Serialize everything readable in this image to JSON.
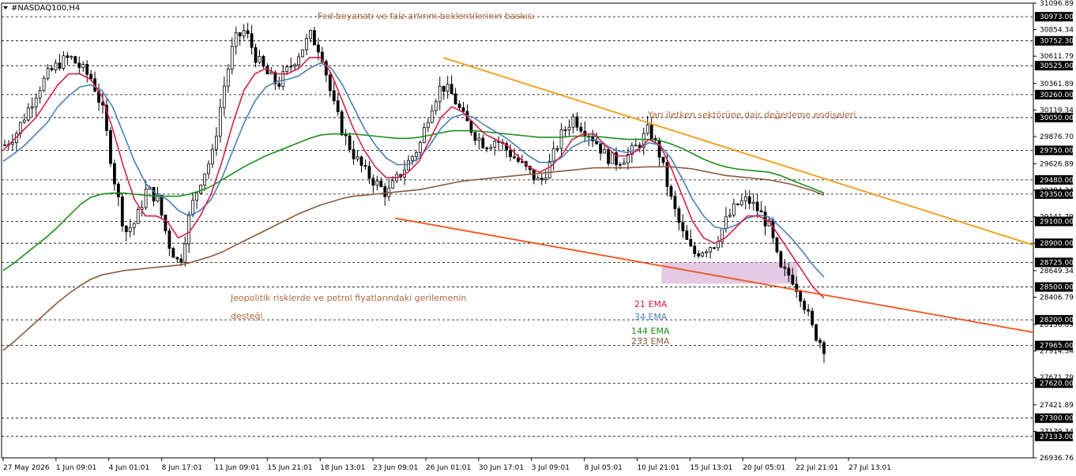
{
  "symbol": "#NASDAQ100,H4",
  "colors": {
    "bull": "#000000",
    "bear": "#000000",
    "ema21": "#d1204a",
    "ema34": "#4a7fb5",
    "ema144": "#1b8f1b",
    "ema233": "#8b5a3c",
    "orange": "#f59a14",
    "redline": "#f2531c",
    "zone": "#d8b4d8",
    "levelTag": "#000000",
    "priceTag": "#000000"
  },
  "annotations": {
    "fed": "Fed beyanatı ve faiz artırım beklentilerinin baskısı",
    "semi": "Yarı iletken sektörüne dair değerleme endişeleri",
    "geo1": "Jeopolitik risklerde ve petrol fiyatlarındaki gerilemenin",
    "geo2": "desteği"
  },
  "legend": [
    "21 EMA",
    "34 EMA",
    "144 EMA",
    "233 EMA"
  ],
  "chart_data": {
    "type": "candlestick",
    "title": "#NASDAQ100,H4",
    "ylim": [
      26936.76,
      31096.89
    ],
    "price_axis_labels": [
      "31096.89",
      "30854.34",
      "30611.79",
      "30361.89",
      "30119.34",
      "29876.70",
      "29626.89",
      "29384.34",
      "29141.79",
      "28900.00",
      "28649.34",
      "28406.79",
      "28156.89",
      "27914.34",
      "27671.79",
      "27421.89",
      "27179.34",
      "26936.76"
    ],
    "horizontal_levels": [
      30973.0,
      30752.3,
      30525.0,
      30260.0,
      30050.0,
      29750.0,
      29480.0,
      29350.0,
      29100.0,
      28900.0,
      28725.0,
      28500.0,
      28200.0,
      27965.0,
      27620.0,
      27300.0,
      27133.0
    ],
    "x_labels": [
      "27 May 2026",
      "1 Jun 09:01",
      "4 Jun 01:01",
      "8 Jun 17:01",
      "11 Jun 09:01",
      "15 Jun 21:01",
      "18 Jun 13:01",
      "23 Jun 09:01",
      "26 Jun 01:01",
      "30 Jun 17:01",
      "3 Jul 09:01",
      "8 Jul 05:01",
      "10 Jul 21:01",
      "15 Jul 13:01",
      "20 Jul 05:01",
      "22 Jul 21:01",
      "27 Jul 13:01"
    ],
    "close_path": [
      29800,
      29900,
      30100,
      30300,
      30450,
      30550,
      30600,
      30500,
      30400,
      30100,
      29500,
      29000,
      29100,
      29400,
      29300,
      28900,
      28700,
      29200,
      29500,
      29700,
      30300,
      30750,
      30850,
      30600,
      30450,
      30350,
      30500,
      30650,
      30800,
      30650,
      30200,
      29900,
      29700,
      29550,
      29450,
      29350,
      29500,
      29650,
      29800,
      30150,
      30350,
      30250,
      30050,
      29900,
      29800,
      29850,
      29750,
      29650,
      29550,
      29450,
      29650,
      29900,
      30050,
      29950,
      29850,
      29700,
      29650,
      29700,
      29800,
      29950,
      29700,
      29300,
      29000,
      28800,
      28850,
      28900,
      29100,
      29250,
      29300,
      29200,
      29050,
      28650,
      28600,
      28400,
      28100,
      27950
    ],
    "ema21_path": [
      29750,
      29850,
      29950,
      30050,
      30200,
      30350,
      30450,
      30450,
      30400,
      30250,
      29950,
      29600,
      29300,
      29150,
      29150,
      29100,
      28950,
      29000,
      29150,
      29350,
      29650,
      30000,
      30300,
      30450,
      30500,
      30450,
      30450,
      30500,
      30600,
      30600,
      30450,
      30200,
      29950,
      29750,
      29600,
      29500,
      29500,
      29550,
      29650,
      29850,
      30050,
      30150,
      30100,
      30000,
      29900,
      29850,
      29800,
      29700,
      29600,
      29550,
      29600,
      29700,
      29850,
      29900,
      29900,
      29800,
      29700,
      29700,
      29750,
      29850,
      29800,
      29600,
      29350,
      29100,
      28950,
      28900,
      28950,
      29050,
      29150,
      29150,
      29100,
      28950,
      28800,
      28650,
      28500,
      28400
    ],
    "ema34_path": [
      29650,
      29720,
      29800,
      29900,
      30000,
      30150,
      30250,
      30330,
      30350,
      30300,
      30150,
      29900,
      29650,
      29450,
      29350,
      29300,
      29200,
      29150,
      29200,
      29300,
      29500,
      29750,
      30000,
      30200,
      30330,
      30380,
      30400,
      30430,
      30500,
      30550,
      30500,
      30350,
      30150,
      29950,
      29800,
      29680,
      29620,
      29620,
      29680,
      29800,
      29950,
      30050,
      30080,
      30050,
      29980,
      29920,
      29860,
      29780,
      29700,
      29640,
      29640,
      29680,
      29780,
      29830,
      29850,
      29800,
      29750,
      29730,
      29760,
      29820,
      29800,
      29680,
      29500,
      29300,
      29150,
      29050,
      29030,
      29070,
      29130,
      29160,
      29140,
      29050,
      28950,
      28830,
      28700,
      28590
    ],
    "ema144_path": [
      28650,
      28720,
      28800,
      28880,
      28960,
      29050,
      29150,
      29250,
      29320,
      29350,
      29360,
      29360,
      29350,
      29340,
      29330,
      29330,
      29330,
      29350,
      29380,
      29420,
      29480,
      29540,
      29600,
      29650,
      29700,
      29740,
      29780,
      29820,
      29860,
      29890,
      29900,
      29900,
      29900,
      29890,
      29880,
      29870,
      29860,
      29860,
      29870,
      29890,
      29910,
      29930,
      29930,
      29930,
      29920,
      29910,
      29900,
      29890,
      29880,
      29870,
      29870,
      29870,
      29880,
      29880,
      29880,
      29870,
      29860,
      29850,
      29850,
      29850,
      29840,
      29810,
      29770,
      29720,
      29670,
      29630,
      29600,
      29580,
      29570,
      29560,
      29550,
      29520,
      29480,
      29440,
      29400,
      29360
    ],
    "ema233_path": [
      27920,
      28000,
      28090,
      28180,
      28270,
      28360,
      28440,
      28510,
      28570,
      28610,
      28630,
      28650,
      28660,
      28670,
      28680,
      28690,
      28700,
      28720,
      28750,
      28780,
      28820,
      28870,
      28920,
      28970,
      29020,
      29070,
      29120,
      29170,
      29210,
      29250,
      29280,
      29310,
      29330,
      29340,
      29350,
      29360,
      29370,
      29380,
      29390,
      29410,
      29430,
      29450,
      29470,
      29480,
      29490,
      29500,
      29510,
      29520,
      29530,
      29540,
      29550,
      29560,
      29570,
      29580,
      29590,
      29590,
      29590,
      29590,
      29595,
      29600,
      29600,
      29600,
      29590,
      29580,
      29560,
      29540,
      29520,
      29510,
      29500,
      29490,
      29480,
      29460,
      29440,
      29410,
      29380,
      29340
    ],
    "trend_lines": [
      {
        "name": "descending-resistance",
        "color": "orange",
        "from": [
          0.4285,
          30597
        ],
        "to": [
          0.9613,
          29000
        ]
      },
      {
        "name": "descending-support",
        "color": "redline",
        "from": [
          0.3812,
          29130
        ],
        "to": [
          0.9613,
          28150
        ]
      }
    ],
    "zone": {
      "x_from": 0.6397,
      "x_to": 0.7713,
      "y_top": 28725,
      "y_bottom": 28530
    }
  }
}
